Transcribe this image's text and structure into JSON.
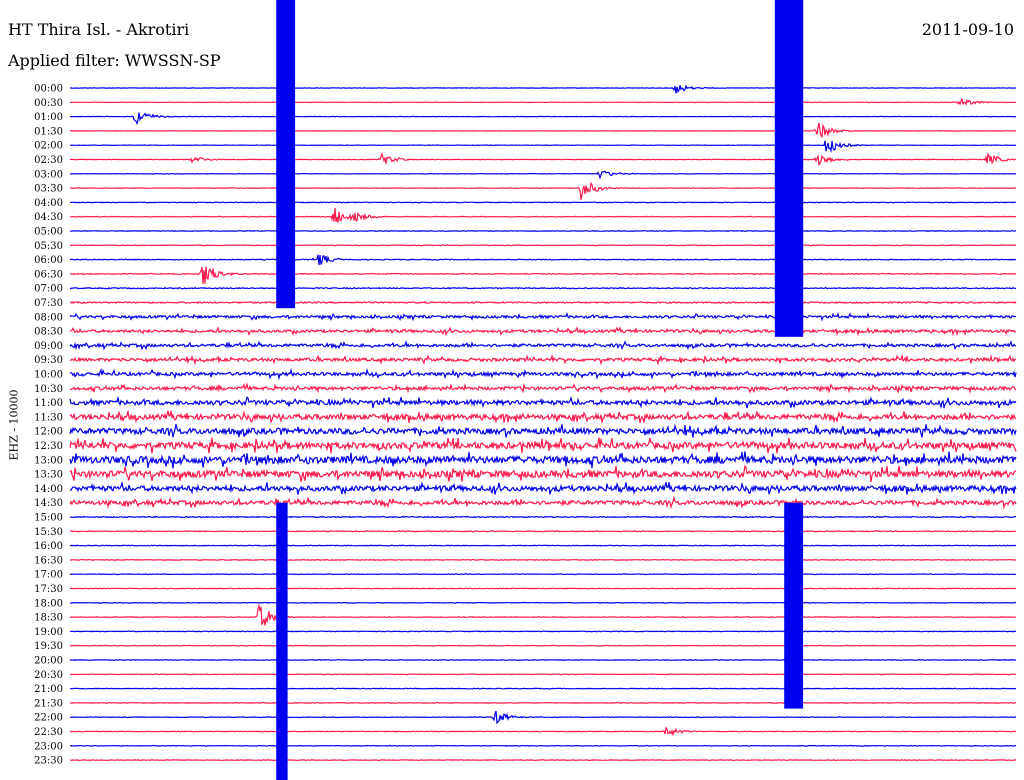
{
  "header": {
    "station": "HT Thira Isl. - Akrotiri",
    "filter": "Applied filter: WWSSN-SP",
    "date": "2011-09-10",
    "channel": "EHZ - 10000"
  },
  "chart_data": {
    "type": "line",
    "plot_kind": "helicorder",
    "categories": [
      "00:00",
      "00:30",
      "01:00",
      "01:30",
      "02:00",
      "02:30",
      "03:00",
      "03:30",
      "04:00",
      "04:30",
      "05:00",
      "05:30",
      "06:00",
      "06:30",
      "07:00",
      "07:30",
      "08:00",
      "08:30",
      "09:00",
      "09:30",
      "10:00",
      "10:30",
      "11:00",
      "11:30",
      "12:00",
      "12:30",
      "13:00",
      "13:30",
      "14:00",
      "14:30",
      "15:00",
      "15:30",
      "16:00",
      "16:30",
      "17:00",
      "17:30",
      "18:00",
      "18:30",
      "19:00",
      "19:30",
      "20:00",
      "20:30",
      "21:00",
      "21:30",
      "22:00",
      "22:30",
      "23:00",
      "23:30"
    ],
    "series_colors": [
      "#0000ee",
      "#ff1a4b"
    ],
    "color_pattern": "alternating lines",
    "relative_noise_level": [
      0.2,
      0.2,
      0.2,
      0.2,
      0.2,
      0.25,
      0.25,
      0.25,
      0.3,
      0.3,
      0.3,
      0.35,
      0.4,
      0.45,
      0.5,
      0.7,
      1.2,
      1.3,
      1.4,
      1.5,
      1.6,
      1.6,
      2.2,
      2.5,
      2.8,
      3.2,
      3.5,
      3.3,
      2.5,
      2.0,
      0.5,
      0.4,
      0.35,
      0.35,
      0.3,
      0.3,
      0.3,
      0.3,
      0.3,
      0.3,
      0.3,
      0.3,
      0.3,
      0.3,
      0.3,
      0.3,
      0.3,
      0.3
    ],
    "events": [
      {
        "line": 0,
        "t": 0.64,
        "amp": 6
      },
      {
        "line": 1,
        "t": 0.94,
        "amp": 5
      },
      {
        "line": 2,
        "t": 0.07,
        "amp": 8
      },
      {
        "line": 3,
        "t": 0.79,
        "amp": 10
      },
      {
        "line": 4,
        "t": 0.8,
        "amp": 9
      },
      {
        "line": 5,
        "t": 0.13,
        "amp": 4
      },
      {
        "line": 5,
        "t": 0.33,
        "amp": 6
      },
      {
        "line": 5,
        "t": 0.79,
        "amp": 6
      },
      {
        "line": 5,
        "t": 0.97,
        "amp": 6
      },
      {
        "line": 6,
        "t": 0.56,
        "amp": 5
      },
      {
        "line": 7,
        "t": 0.54,
        "amp": 12
      },
      {
        "line": 9,
        "t": 0.28,
        "amp": 10
      },
      {
        "line": 9,
        "t": 0.3,
        "amp": 7
      },
      {
        "line": 12,
        "t": 0.26,
        "amp": 8
      },
      {
        "line": 13,
        "t": 0.14,
        "amp": 14
      },
      {
        "line": 37,
        "t": 0.2,
        "amp": 14
      },
      {
        "line": 44,
        "t": 0.45,
        "amp": 7
      },
      {
        "line": 45,
        "t": 0.63,
        "amp": 6
      }
    ],
    "saturated_bursts": [
      {
        "t": 0.218,
        "width": 0.02,
        "lines": [
          0,
          14
        ]
      },
      {
        "t": 0.745,
        "width": 0.03,
        "lines": [
          0,
          16
        ]
      },
      {
        "t": 0.218,
        "width": 0.012,
        "lines": [
          29,
          47
        ]
      },
      {
        "t": 0.755,
        "width": 0.02,
        "lines": [
          29,
          42
        ]
      }
    ],
    "xlabel": "",
    "ylabel": ""
  }
}
